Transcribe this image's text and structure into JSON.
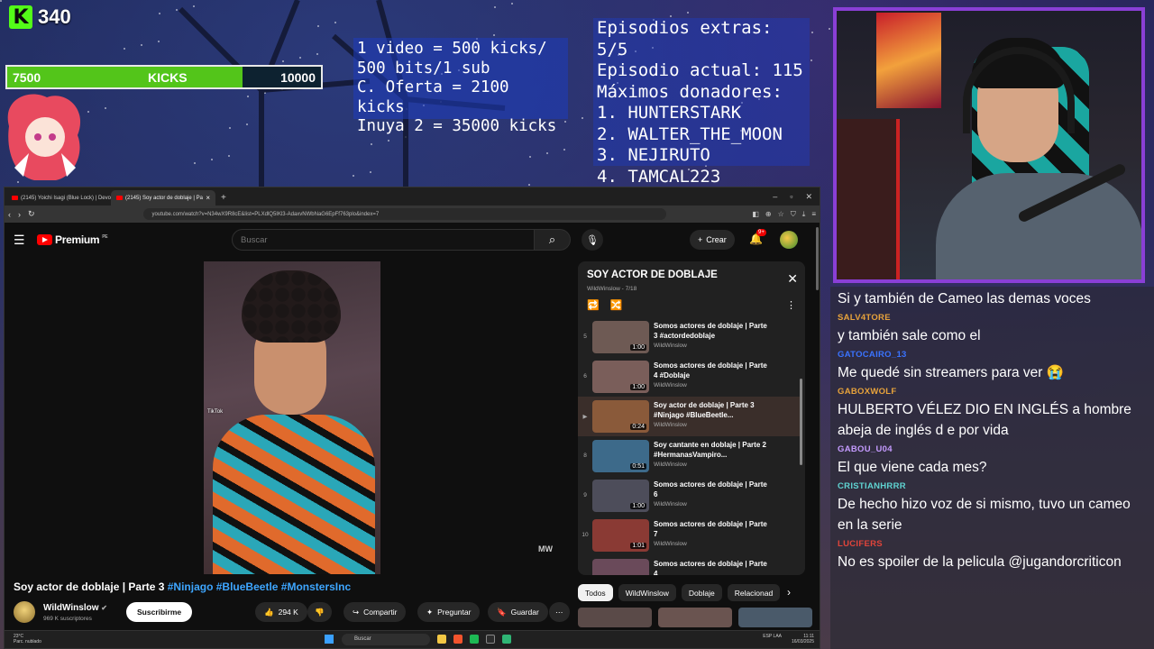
{
  "kick": {
    "count": "340",
    "logo_letter": "K",
    "goal_start": "7500",
    "goal_label": "KICKS",
    "goal_end": "10000",
    "goal_progress": 0.75
  },
  "promo_lines": [
    "1 video = 500 kicks/",
    "500 bits/1 sub",
    "C. Oferta = 2100 kicks",
    "Inuya 2 = 35000 kicks"
  ],
  "stats_lines": [
    "Episodios extras: 5/5",
    "Episodio actual: 115",
    "Máximos donadores:",
    "1. HUNTERSTARK",
    "2. WALTER_THE_MOON",
    "3. NEJIRUTO",
    "4. TAMCAL223"
  ],
  "chat": [
    {
      "user": "",
      "color": "#ffffff",
      "text": "Si y también de Cameo las demas voces"
    },
    {
      "user": "SALV4TORE",
      "color": "#e8a33b",
      "text": "y también sale como el"
    },
    {
      "user": "GATOCAIRO_13",
      "color": "#3a73ff",
      "text": "Me quedé sin streamers para ver 😭"
    },
    {
      "user": "GABOXWOLF",
      "color": "#e8a33b",
      "text": "HULBERTO VÉLEZ DIO EN INGLÉS a hombre abeja de inglés d e por vida"
    },
    {
      "user": "GABOU_U04",
      "color": "#c59bff",
      "text": "El que viene cada mes?"
    },
    {
      "user": "CRISTIANHRRR",
      "color": "#5fd3d1",
      "text": "De hecho hizo voz de si mismo, tuvo un cameo en la serie"
    },
    {
      "user": "LUCIFERS",
      "color": "#e0443a",
      "text": "No es spoiler de la pelicula @jugandorcriticon"
    }
  ],
  "browser": {
    "tabs": [
      {
        "label": "(2145) Yoichi Isagi (Blue Lock) | Devo",
        "active": false
      },
      {
        "label": "(2145) Soy actor de doblaje | Pa",
        "active": true
      }
    ],
    "url": "youtube.com/watch?v=N34wX9R8cE&list=PLXdlQ5IKl3-AdaxvNWbNaG6EpFf763plo&index=7"
  },
  "youtube": {
    "logo_text": "Premium",
    "logo_region": "PE",
    "search_placeholder": "Buscar",
    "create_label": "Crear",
    "notif_count": "9+",
    "tiktok_label": "TikTok",
    "watermark": "MW",
    "playlist": {
      "title": "SOY ACTOR DE DOBLAJE",
      "subtitle": "WildWinslow - 7/18",
      "items": [
        {
          "index": "5",
          "title": "Somos actores de doblaje | Parte 3 #actordedoblaje",
          "channel": "WildWinslow",
          "duration": "1:00",
          "thumb": "#6e5a54",
          "current": false
        },
        {
          "index": "6",
          "title": "Somos actores de doblaje | Parte 4 #Doblaje",
          "channel": "WildWinslow",
          "duration": "1:00",
          "thumb": "#7a5e5a",
          "current": false
        },
        {
          "index": "▶",
          "title": "Soy actor de doblaje | Parte 3 #Ninjago #BlueBeetle...",
          "channel": "WildWinslow",
          "duration": "0:24",
          "thumb": "#8a5a3a",
          "current": true
        },
        {
          "index": "8",
          "title": "Soy cantante en doblaje | Parte 2 #HermanasVampiro...",
          "channel": "WildWinslow",
          "duration": "0:51",
          "thumb": "#3d6a8a",
          "current": false
        },
        {
          "index": "9",
          "title": "Somos actores de doblaje | Parte 6",
          "channel": "WildWinslow",
          "duration": "1:00",
          "thumb": "#4d4d5a",
          "current": false
        },
        {
          "index": "10",
          "title": "Somos actores de doblaje | Parte 7",
          "channel": "WildWinslow",
          "duration": "1:01",
          "thumb": "#8a3a34",
          "current": false
        },
        {
          "index": "",
          "title": "Somos actores de doblaje | Parte 4",
          "channel": "",
          "duration": "",
          "thumb": "#6a4a5a",
          "current": false
        }
      ]
    },
    "video_title_main": "Soy actor de doblaje | Parte 3 ",
    "video_title_tags": "#Ninjago #BlueBeetle #MonstersInc",
    "channel_name": "WildWinslow",
    "subscribers": "969 K suscriptores",
    "subscribe_label": "Suscribirme",
    "likes": "294 K",
    "share_label": "Compartir",
    "ask_label": "Preguntar",
    "save_label": "Guardar",
    "chips": [
      "Todos",
      "WildWinslow",
      "Doblaje",
      "Relacionad"
    ]
  },
  "taskbar": {
    "weather_temp": "23°C",
    "weather_desc": "Parc. nublado",
    "search_placeholder": "Buscar",
    "lang": "ESP LAA",
    "time": "11:11",
    "date": "16/03/2025"
  }
}
